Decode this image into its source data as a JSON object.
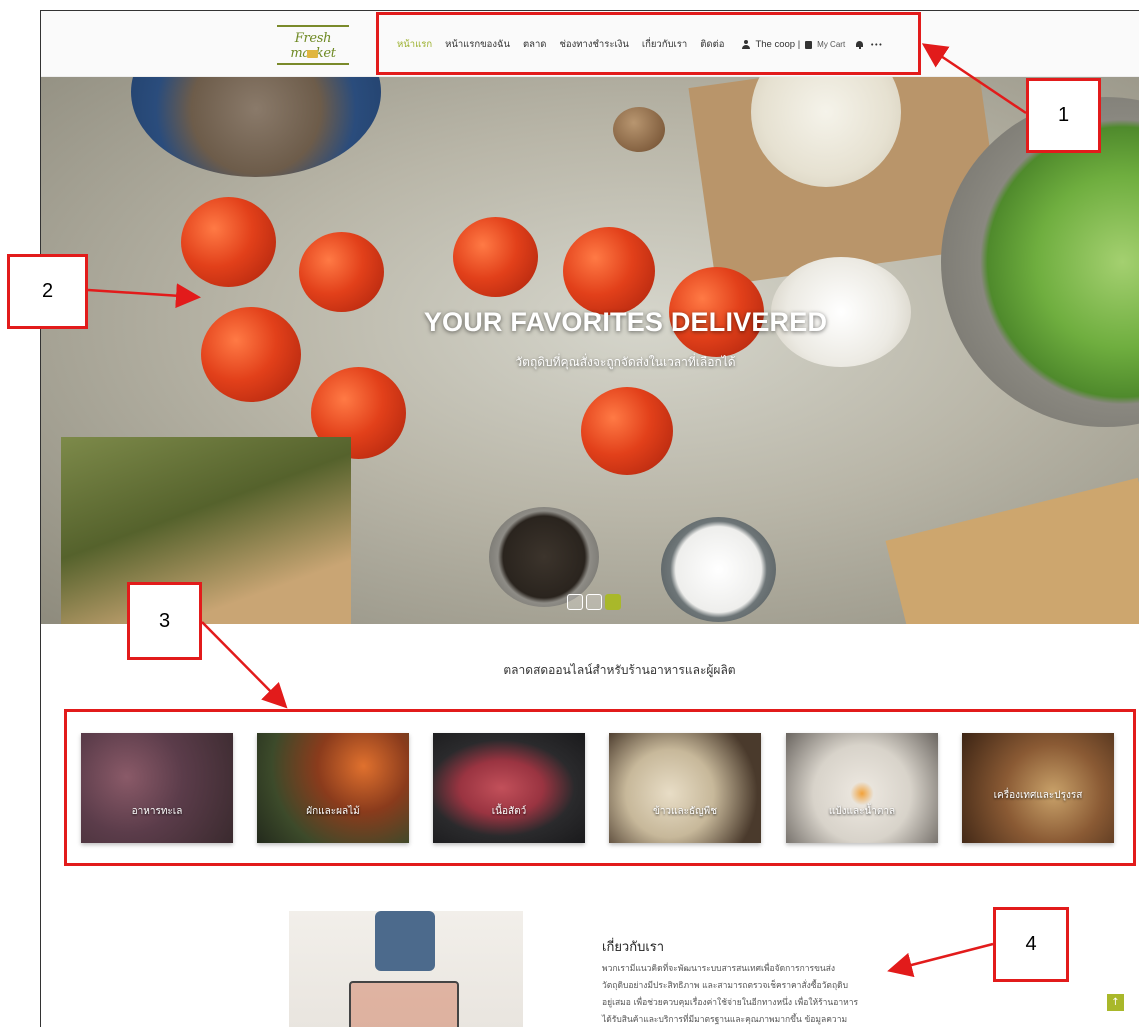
{
  "header": {
    "logo_text": "Fresh market",
    "nav": [
      "หน้าแรก",
      "หน้าแรกของฉัน",
      "ตลาด",
      "ช่องทางชำระเงิน",
      "เกี่ยวกับเรา",
      "ติดต่อ"
    ],
    "active_index": 0,
    "user_label": "The coop |",
    "cart_label": "My Cart",
    "more_label": "•••"
  },
  "hero": {
    "title": "YOUR FAVORITES DELIVERED",
    "subtitle": "วัตถุดิบที่คุณสั่งจะถูกจัดส่งในเวลาที่เลือกได้",
    "slides": 3,
    "active_slide": 2
  },
  "section": {
    "title": "ตลาดสดออนไลน์สำหรับร้านอาหารและผู้ผลิต"
  },
  "categories": [
    {
      "label": "อาหารทะเล"
    },
    {
      "label": "ผักและผลไม้"
    },
    {
      "label": "เนื้อสัตว์"
    },
    {
      "label": "ข้าวและธัญพืช"
    },
    {
      "label": "แป้งและน้ำตาล"
    },
    {
      "label": "เครื่องเทศและปรุงรส"
    }
  ],
  "about": {
    "title": "เกี่ยวกับเรา",
    "lines": [
      "พวกเรามีแนวคิดที่จะพัฒนาระบบสารสนเทศเพื่อจัดการการขนส่ง",
      "วัตถุดิบอย่างมีประสิทธิภาพ และสามารถตรวจเช็คราคาสั่งซื้อวัตถุดิบ",
      "อยู่เสมอ เพื่อช่วยควบคุมเรื่องค่าใช้จ่ายในอีกทางหนึ่ง เพื่อให้ร้านอาหาร",
      "ได้รับสินค้าและบริการที่มีมาตรฐานและคุณภาพมากขึ้น ข้อมูลความ"
    ]
  },
  "back_to_top": "↑",
  "annotations": [
    "1",
    "2",
    "3",
    "4"
  ],
  "colors": {
    "accent": "#a9b82a",
    "annotation": "#e21b1b"
  }
}
